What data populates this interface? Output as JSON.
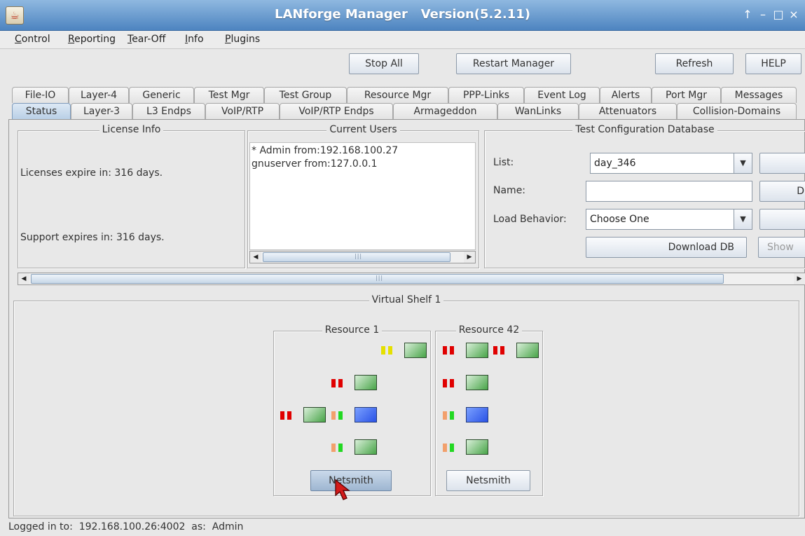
{
  "window": {
    "title": "LANforge Manager   Version(5.2.11)",
    "icon_glyph": "☕",
    "controls": {
      "pin": "↑",
      "minimize": "–",
      "maximize": "□",
      "close": "×"
    }
  },
  "menu": {
    "control": {
      "mnemonic": "C",
      "rest": "ontrol"
    },
    "reporting": {
      "mnemonic": "R",
      "rest": "eporting"
    },
    "tearoff": {
      "mnemonic": "T",
      "rest": "ear-Off"
    },
    "info": {
      "mnemonic": "I",
      "rest": "nfo"
    },
    "plugins": {
      "mnemonic": "P",
      "rest": "lugins"
    }
  },
  "toolbar": {
    "stop_all": "Stop All",
    "restart_manager": "Restart Manager",
    "refresh": "Refresh",
    "help": "HELP"
  },
  "tabs": {
    "row1": [
      "File-IO",
      "Layer-4",
      "Generic",
      "Test Mgr",
      "Test Group",
      "Resource Mgr",
      "PPP-Links",
      "Event Log",
      "Alerts",
      "Port Mgr",
      "Messages"
    ],
    "row2": [
      "Status",
      "Layer-3",
      "L3 Endps",
      "VoIP/RTP",
      "VoIP/RTP Endps",
      "Armageddon",
      "WanLinks",
      "Attenuators",
      "Collision-Domains"
    ],
    "selected": "Status"
  },
  "license_info": {
    "title": "License Info",
    "licenses_expire": "Licenses expire in: 316 days.",
    "support_expires": "Support expires in: 316 days."
  },
  "current_users": {
    "title": "Current Users",
    "users": [
      "* Admin from:192.168.100.27",
      "gnuserver from:127.0.0.1"
    ]
  },
  "test_config_db": {
    "title": "Test Configuration Database",
    "list_label": "List:",
    "list_value": "day_346",
    "name_label": "Name:",
    "name_value": "",
    "load_behavior_label": "Load Behavior:",
    "load_behavior_value": "Choose One",
    "download_db": "Download DB",
    "show_label": "Show",
    "clipped_button_glyph": "D"
  },
  "virtual_shelf": {
    "title": "Virtual Shelf 1",
    "resources": [
      {
        "title": "Resource 1",
        "button": "Netsmith"
      },
      {
        "title": "Resource 42",
        "button": "Netsmith"
      }
    ]
  },
  "status_bar": {
    "text": "Logged in to:  192.168.100.26:4002  as:  Admin"
  },
  "colors": {
    "selected_tab": "#b9cfe6",
    "led_red": "#e00000",
    "led_yellow": "#e5e000",
    "led_green": "#22d822",
    "led_orange": "#f2a06c",
    "port_green": "#48a448",
    "port_blue": "#2a52e6"
  }
}
